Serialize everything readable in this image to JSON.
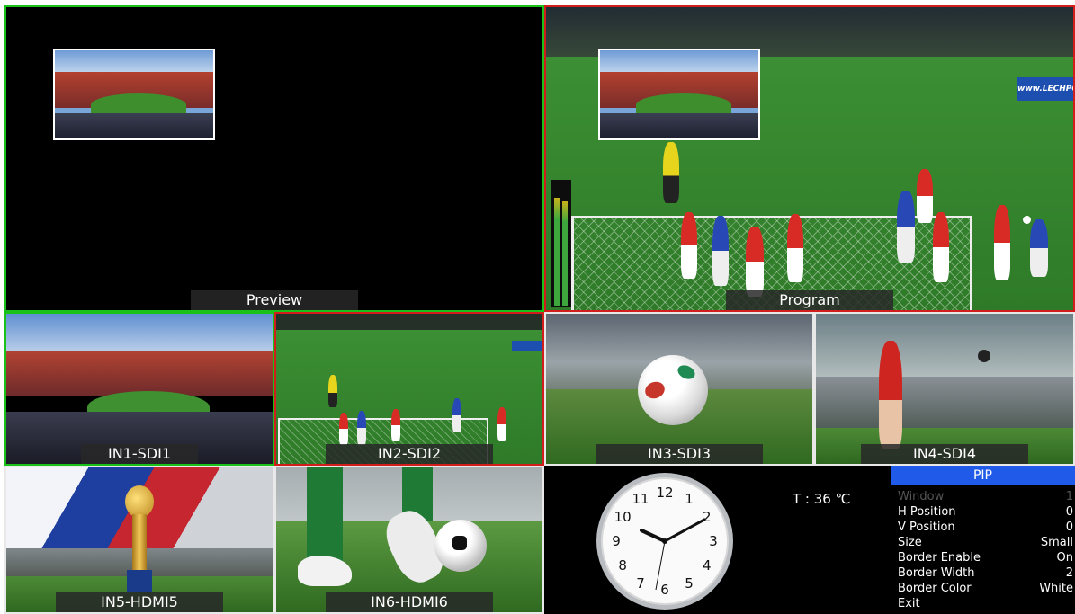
{
  "views": {
    "preview_label": "Preview",
    "program_label": "Program",
    "inputs": [
      "IN1-SDI1",
      "IN2-SDI2",
      "IN3-SDI3",
      "IN4-SDI4",
      "IN5-HDMI5",
      "IN6-HDMI6"
    ]
  },
  "status": {
    "temperature": "T : 36 ℃"
  },
  "clock": {
    "numbers": [
      "12",
      "1",
      "2",
      "3",
      "4",
      "5",
      "6",
      "7",
      "8",
      "9",
      "10",
      "11"
    ]
  },
  "pip_menu": {
    "title": "PIP",
    "items": [
      {
        "label": "Window",
        "value": "1"
      },
      {
        "label": "H Position",
        "value": "0"
      },
      {
        "label": "V Position",
        "value": "0"
      },
      {
        "label": "Size",
        "value": "Small"
      },
      {
        "label": "Border Enable",
        "value": "On"
      },
      {
        "label": "Border Width",
        "value": "2"
      },
      {
        "label": "Border Color",
        "value": "White"
      },
      {
        "label": "Exit",
        "value": ""
      }
    ]
  },
  "colors": {
    "preview_border": "#18c218",
    "program_border": "#d21d1d",
    "menu_header": "#1f5ae8"
  }
}
